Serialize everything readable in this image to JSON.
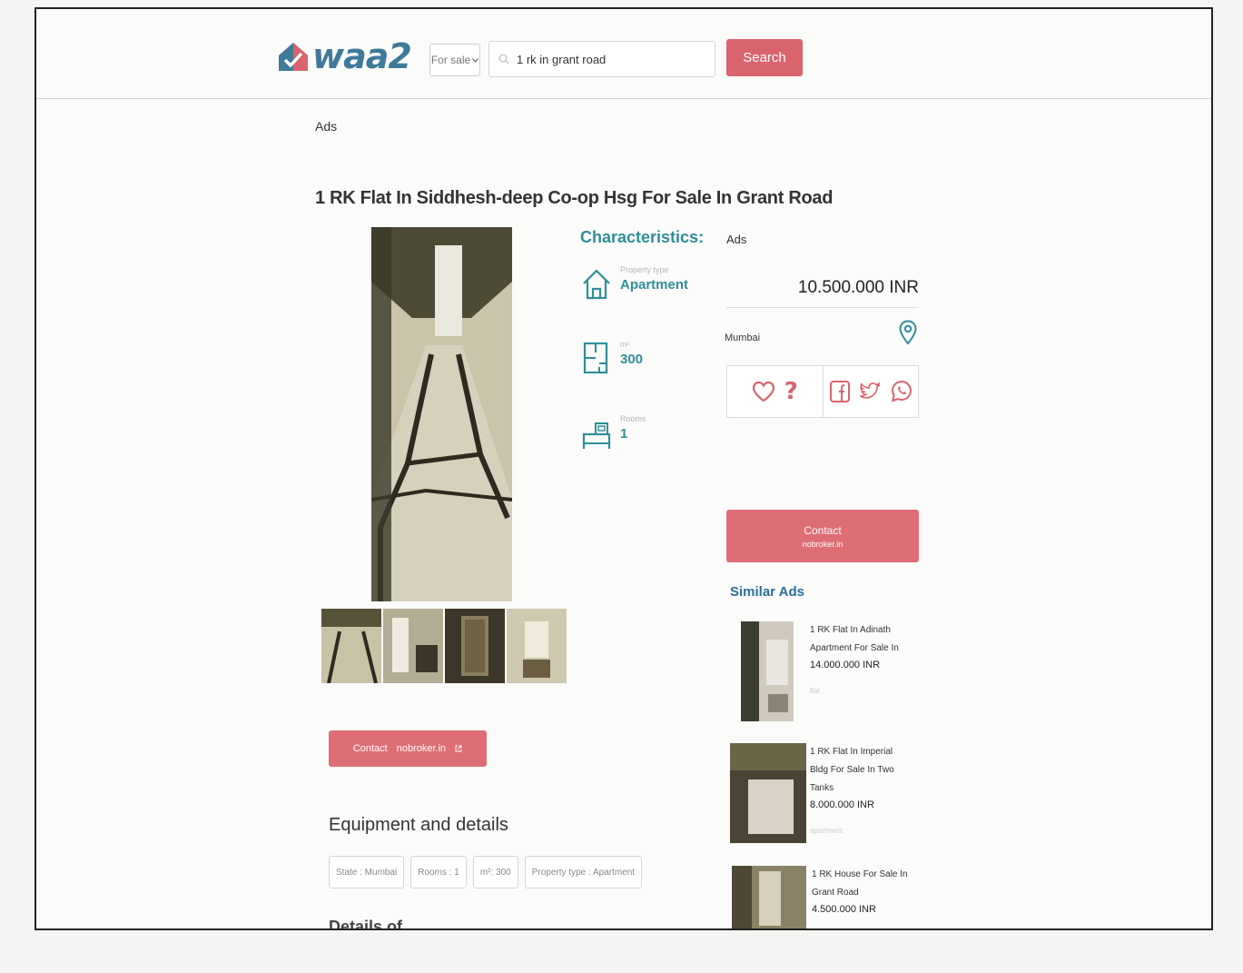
{
  "header": {
    "logo_text": "waa2",
    "sale_select": "For sale",
    "search_value": "1 rk in grant road",
    "search_button": "Search"
  },
  "ads_label_top": "Ads",
  "listing": {
    "title": "1 RK Flat In Siddhesh-deep Co-op Hsg For Sale In Grant Road",
    "contact_label": "Contact",
    "contact_source": "nobroker.in"
  },
  "characteristics": {
    "title": "Characteristics:",
    "items": [
      {
        "label": "Property type",
        "value": "Apartment",
        "icon": "house-icon"
      },
      {
        "label": "m²",
        "value": "300",
        "icon": "floorplan-icon"
      },
      {
        "label": "Rooms",
        "value": "1",
        "icon": "bed-icon"
      }
    ]
  },
  "sidebar": {
    "ads_label": "Ads",
    "price": "10.500.000 INR",
    "city": "Mumbai",
    "contact_label": "Contact",
    "contact_source": "nobroker.in",
    "similar_title": "Similar Ads",
    "similar": [
      {
        "name": "1 RK Flat In Adinath Apartment For Sale In",
        "price": "14.000.000 INR",
        "type": "flat"
      },
      {
        "name": "1 RK Flat In Imperial Bldg For Sale In Two Tanks",
        "price": "8.000.000 INR",
        "type": "apartment"
      },
      {
        "name": "1 RK House For Sale In Grant Road",
        "price": "4.500.000 INR",
        "type": ""
      }
    ]
  },
  "equipment": {
    "title": "Equipment and details",
    "chips": [
      "State : Mumbai",
      "Rooms : 1",
      "m²: 300",
      "Property type : Apartment"
    ],
    "details_title": "Details of"
  },
  "colors": {
    "accent": "#d9646d",
    "teal": "#2f8e9a",
    "link_blue": "#2a6f99"
  }
}
